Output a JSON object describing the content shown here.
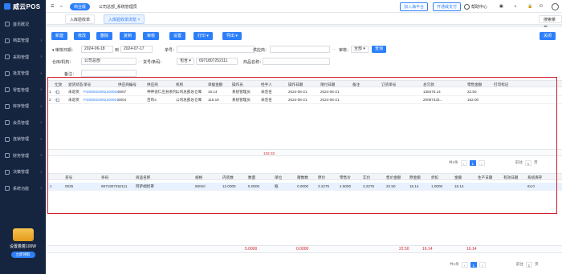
{
  "app": {
    "logo": "威云POS"
  },
  "sidebar": {
    "items": [
      {
        "label": "首页概况",
        "icon": "home-icon"
      },
      {
        "label": "档案管理",
        "icon": "folder-icon"
      },
      {
        "label": "采购管理",
        "icon": "cart-icon"
      },
      {
        "label": "批发管理",
        "icon": "truck-icon"
      },
      {
        "label": "零售管理",
        "icon": "store-icon"
      },
      {
        "label": "库存管理",
        "icon": "box-icon"
      },
      {
        "label": "会员管理",
        "icon": "user-icon"
      },
      {
        "label": "连锁管理",
        "icon": "chain-icon"
      },
      {
        "label": "财务管理",
        "icon": "money-icon"
      },
      {
        "label": "决策管理",
        "icon": "chart-icon"
      },
      {
        "label": "系统功能",
        "icon": "gear-icon"
      }
    ],
    "promo": {
      "text": "设置着着100W",
      "button": "立即领取"
    }
  },
  "topbar": {
    "store_chip": "商业版",
    "company": "公司总部_系统管理员",
    "btn_join": "加入海平台",
    "btn_cashier": "开通威支付",
    "help": "帮助中心"
  },
  "tabs": [
    {
      "label": "入库验收单"
    },
    {
      "label": "入库验收单浏览",
      "active": true
    }
  ],
  "search_menu": "搜索菜单",
  "toolbar": {
    "buttons": [
      "新建",
      "修改",
      "删除",
      "复制",
      "审核",
      "设置",
      "打印",
      "导出"
    ],
    "close": "关闭"
  },
  "filters": {
    "date_label": "审核日期：",
    "date_from": "2024-06-18",
    "to_label": "到",
    "date_to": "2024-07-17",
    "docno_label": "单号：",
    "docno": "",
    "supplier_label": "供应商：",
    "supplier": "",
    "audit_label": "审核：",
    "audit_value": "全部",
    "query": "查询",
    "org_label": "仓库/机构：",
    "org": "公司总部",
    "barcode_label": "货号/条码：",
    "barcode_mode": "包含",
    "barcode": "6971807252111",
    "goods_label": "商品名称：",
    "goods": "",
    "remark_label": "备注："
  },
  "master": {
    "headers": [
      "",
      "生效",
      "退货状态",
      "单号",
      "供应商编号",
      "供应商",
      "机构",
      "单据金额",
      "操作员",
      "经手人",
      "操作日期",
      "限付日期",
      "备注",
      "订货单号",
      "总欠款",
      "零售金额",
      "打印标记"
    ],
    "rows": [
      [
        "1",
        "√",
        "未退货",
        "PJ000024062100002",
        "0007",
        "神神会仁庄县系列",
        "公司总部总仓库",
        "16.14",
        "系统管理员",
        "未签名",
        "2024-06-21",
        "2024-06-21",
        "",
        "",
        "138476.14",
        "22.50",
        ""
      ],
      [
        "2",
        "√",
        "未退货",
        "PJ000024062100001",
        "0004",
        "百鸣4",
        "公司总部总仓库",
        "116.19",
        "系统管理员",
        "未签名",
        "2024-06-21",
        "2024-06-21",
        "",
        "",
        "20097433...",
        "162.00",
        ""
      ]
    ],
    "total": "132.33",
    "pager": {
      "total_text": "共2条",
      "page": "1",
      "goto_label": "前往",
      "goto_value": "1",
      "page_unit": "页"
    }
  },
  "detail": {
    "headers": [
      "货号",
      "条码",
      "商品名称",
      "规格",
      "内装数",
      "数量",
      "单位",
      "赠数数",
      "原价",
      "零售价",
      "实价",
      "售价金额",
      "原金额",
      "折扣",
      "金额",
      "生产日期",
      "有效日期",
      "系统库存"
    ],
    "rows": [
      [
        "1",
        "0025",
        "6971807252111",
        "阿萨姆奶茶",
        "500ml",
        "12.0000",
        "5.0000",
        "瓶",
        "0.0000",
        "3.2275",
        "4.5000",
        "3.2275",
        "22.50",
        "16.14",
        "1.0000",
        "16.14",
        "",
        "",
        "84.0"
      ]
    ],
    "pager": {
      "total_text": "共1条",
      "page": "1",
      "goto_label": "前往",
      "goto_value": "1",
      "page_unit": "页"
    }
  },
  "footer_totals": {
    "qty": "5.0000",
    "gift": "0.0000",
    "sale": "22.50",
    "orig": "16.14",
    "amount": "16.14"
  }
}
